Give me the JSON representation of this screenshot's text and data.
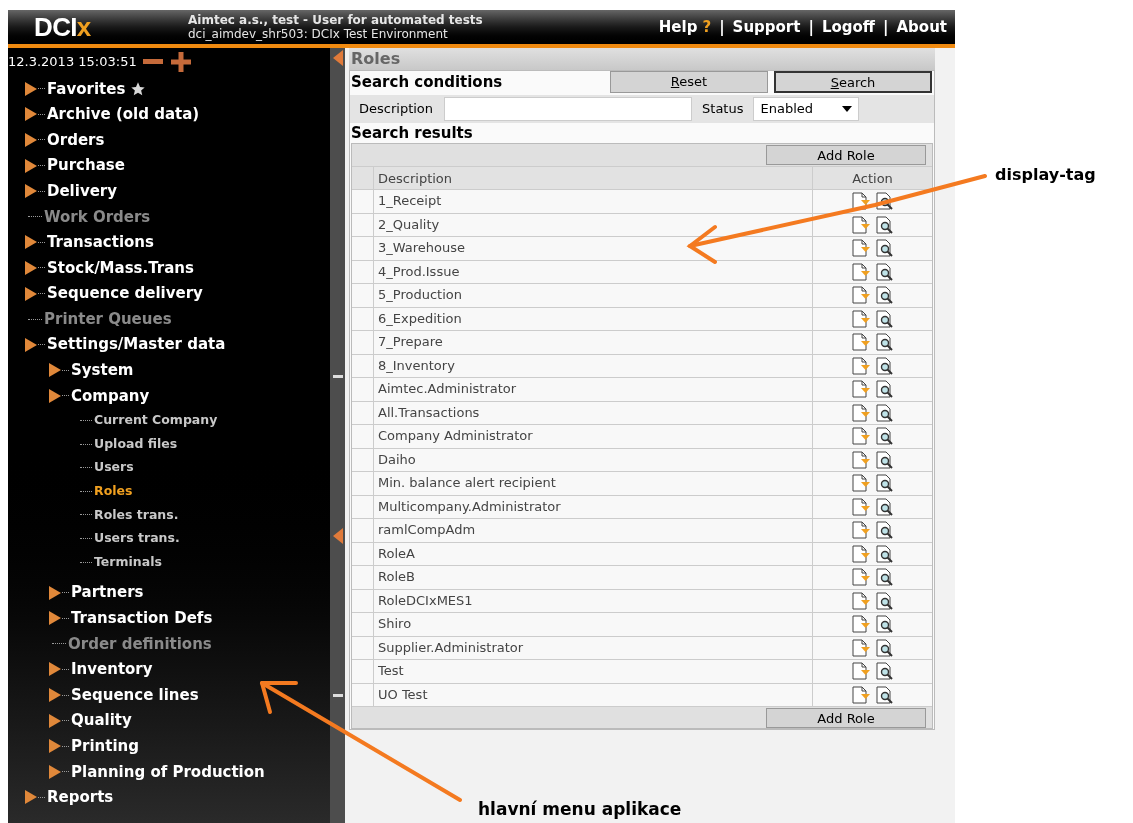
{
  "header": {
    "logo": {
      "text": "DCI",
      "mark": "x"
    },
    "title": "Aimtec a.s., test - User for automated tests",
    "subtitle": "dci_aimdev_shr503: DCIx Test Environment",
    "nav": [
      {
        "kind": "link",
        "label": "Help",
        "suffix": "?"
      },
      {
        "kind": "separator",
        "label": "|"
      },
      {
        "kind": "link",
        "label": "Support"
      },
      {
        "kind": "separator",
        "label": "|"
      },
      {
        "kind": "link",
        "label": "Logoff"
      },
      {
        "kind": "separator",
        "label": "|"
      },
      {
        "kind": "link",
        "label": "About"
      }
    ]
  },
  "sidebar": {
    "datetime": "12.3.2013 15:03:51",
    "menu": [
      {
        "label": "Favorites",
        "kind": "folder",
        "starred": true,
        "disabled": false
      },
      {
        "label": "Archive (old data)",
        "kind": "folder",
        "starred": false,
        "disabled": false
      },
      {
        "label": "Orders",
        "kind": "folder",
        "starred": false,
        "disabled": false
      },
      {
        "label": "Purchase",
        "kind": "folder",
        "starred": false,
        "disabled": false
      },
      {
        "label": "Delivery",
        "kind": "folder",
        "starred": false,
        "disabled": false
      },
      {
        "label": "Work Orders",
        "kind": "link",
        "starred": false,
        "disabled": true
      },
      {
        "label": "Transactions",
        "kind": "folder",
        "starred": false,
        "disabled": false
      },
      {
        "label": "Stock/Mass.Trans",
        "kind": "folder",
        "starred": false,
        "disabled": false
      },
      {
        "label": "Sequence delivery",
        "kind": "folder",
        "starred": false,
        "disabled": false
      },
      {
        "label": "Printer Queues",
        "kind": "link",
        "starred": false,
        "disabled": true
      },
      {
        "label": "Settings/Master data",
        "kind": "folder",
        "starred": false,
        "disabled": false,
        "children": [
          {
            "label": "System",
            "kind": "folder",
            "disabled": false
          },
          {
            "label": "Company",
            "kind": "folder",
            "disabled": false,
            "children": [
              {
                "label": "Current Company",
                "kind": "link",
                "selected": false
              },
              {
                "label": "Upload files",
                "kind": "link",
                "selected": false
              },
              {
                "label": "Users",
                "kind": "link",
                "selected": false
              },
              {
                "label": "Roles",
                "kind": "link",
                "selected": true
              },
              {
                "label": "Roles trans.",
                "kind": "link",
                "selected": false
              },
              {
                "label": "Users trans.",
                "kind": "link",
                "selected": false
              },
              {
                "label": "Terminals",
                "kind": "link",
                "selected": false
              }
            ]
          },
          {
            "label": "Partners",
            "kind": "folder",
            "disabled": false
          },
          {
            "label": "Transaction Defs",
            "kind": "folder",
            "disabled": false
          },
          {
            "label": "Order definitions",
            "kind": "link",
            "disabled": true
          },
          {
            "label": "Inventory",
            "kind": "folder",
            "disabled": false
          },
          {
            "label": "Sequence lines",
            "kind": "folder",
            "disabled": false
          },
          {
            "label": "Quality",
            "kind": "folder",
            "disabled": false
          },
          {
            "label": "Printing",
            "kind": "folder",
            "disabled": false
          },
          {
            "label": "Planning of Production",
            "kind": "folder",
            "disabled": false
          }
        ]
      },
      {
        "label": "Reports",
        "kind": "folder",
        "starred": false,
        "disabled": false
      }
    ]
  },
  "page": {
    "title": "Roles",
    "search_title": "Search conditions",
    "buttons": [
      "Reset",
      "Search"
    ],
    "fields": [
      {
        "label": "Description"
      }
    ],
    "status": {
      "label": "Status",
      "value": "Enabled"
    },
    "results_title": "Search results",
    "add_button": "Add Role",
    "table": {
      "columns": [
        "Description",
        "Action"
      ],
      "rows": [
        "1_Receipt",
        "2_Quality",
        "3_Warehouse",
        "4_Prod.Issue",
        "5_Production",
        "6_Expedition",
        "7_Prepare",
        "8_Inventory",
        "Aimtec.Administrator",
        "All.Transactions",
        "Company Administrator",
        "Daiho",
        "Min. balance alert recipient",
        "Multicompany.Administrator",
        "ramlCompAdm",
        "RoleA",
        "RoleB",
        "RoleDCIxMES1",
        "Shiro",
        "Supplier.Administrator",
        "Test",
        "UO Test"
      ]
    },
    "bottom_button": "Add Role"
  },
  "annotations": [
    {
      "label": "display-tag"
    },
    {
      "label": "hlavní menu aplikace"
    }
  ]
}
